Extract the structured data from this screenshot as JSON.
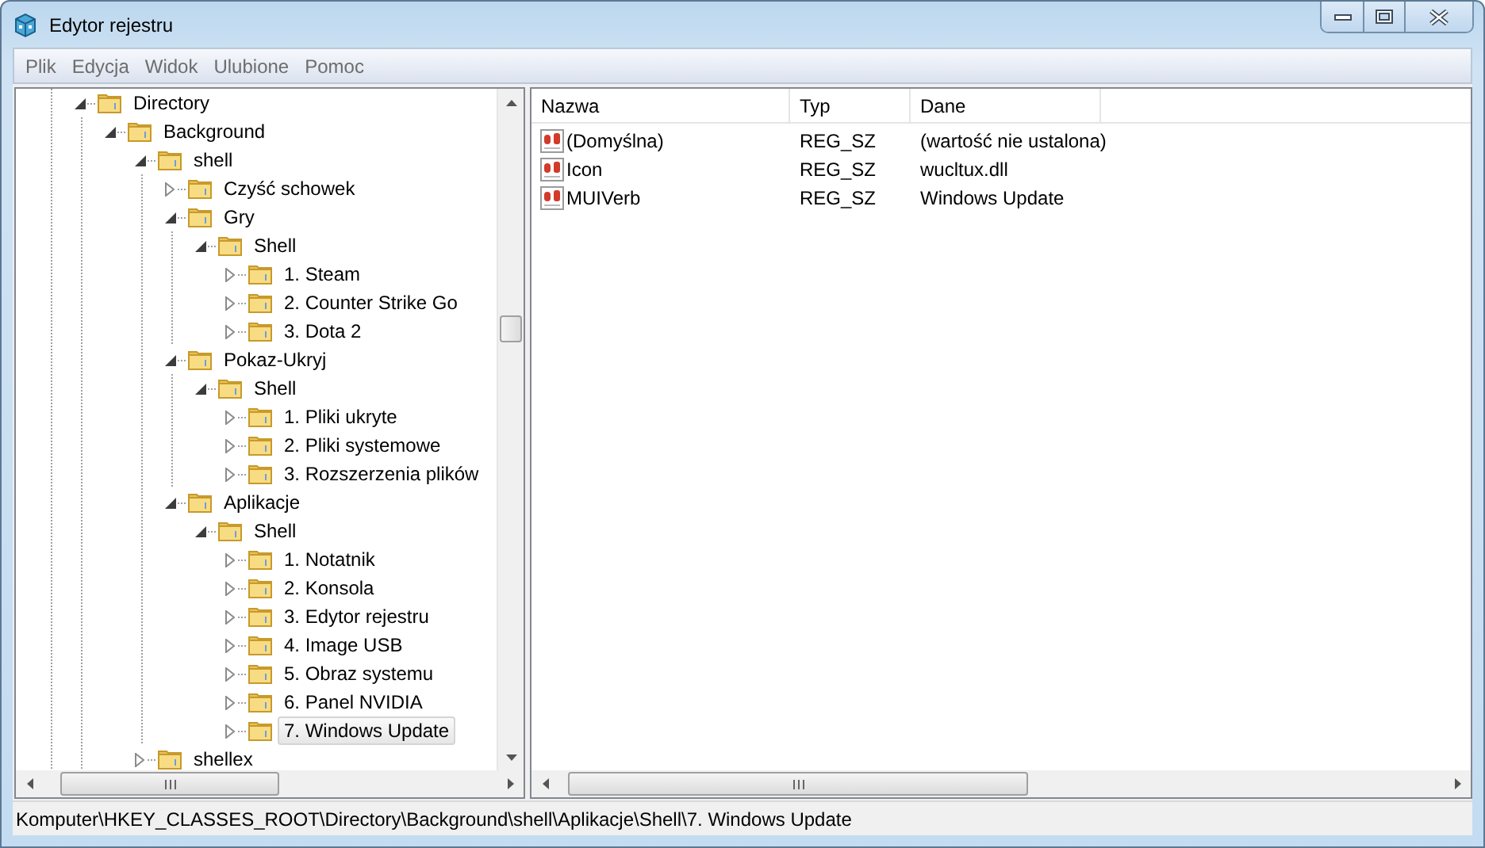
{
  "window": {
    "title": "Edytor rejestru"
  },
  "menu": [
    {
      "label": "Plik",
      "disabled": true
    },
    {
      "label": "Edycja",
      "disabled": true
    },
    {
      "label": "Widok",
      "disabled": true
    },
    {
      "label": "Ulubione",
      "disabled": true
    },
    {
      "label": "Pomoc",
      "disabled": true
    }
  ],
  "tree": [
    {
      "label": "Directory",
      "expanded": true,
      "selected": false,
      "children": [
        {
          "label": "Background",
          "expanded": true,
          "selected": false,
          "children": [
            {
              "label": "shell",
              "expanded": true,
              "selected": false,
              "children": [
                {
                  "label": "Czyść schowek",
                  "expanded": false,
                  "selected": false
                },
                {
                  "label": "Gry",
                  "expanded": true,
                  "selected": false,
                  "children": [
                    {
                      "label": "Shell",
                      "expanded": true,
                      "selected": false,
                      "children": [
                        {
                          "label": "1. Steam",
                          "expanded": false,
                          "selected": false
                        },
                        {
                          "label": "2. Counter Strike Go",
                          "expanded": false,
                          "selected": false
                        },
                        {
                          "label": "3. Dota 2",
                          "expanded": false,
                          "selected": false
                        }
                      ]
                    }
                  ]
                },
                {
                  "label": "Pokaz-Ukryj",
                  "expanded": true,
                  "selected": false,
                  "children": [
                    {
                      "label": "Shell",
                      "expanded": true,
                      "selected": false,
                      "children": [
                        {
                          "label": "1. Pliki ukryte",
                          "expanded": false,
                          "selected": false
                        },
                        {
                          "label": "2. Pliki systemowe",
                          "expanded": false,
                          "selected": false
                        },
                        {
                          "label": "3. Rozszerzenia plików",
                          "expanded": false,
                          "selected": false
                        }
                      ]
                    }
                  ]
                },
                {
                  "label": "Aplikacje",
                  "expanded": true,
                  "selected": false,
                  "children": [
                    {
                      "label": "Shell",
                      "expanded": true,
                      "selected": false,
                      "children": [
                        {
                          "label": "1. Notatnik",
                          "expanded": false,
                          "selected": false
                        },
                        {
                          "label": "2. Konsola",
                          "expanded": false,
                          "selected": false
                        },
                        {
                          "label": "3. Edytor rejestru",
                          "expanded": false,
                          "selected": false
                        },
                        {
                          "label": "4. Image USB",
                          "expanded": false,
                          "selected": false
                        },
                        {
                          "label": "5. Obraz systemu",
                          "expanded": false,
                          "selected": false
                        },
                        {
                          "label": "6. Panel NVIDIA",
                          "expanded": false,
                          "selected": false
                        },
                        {
                          "label": "7. Windows Update",
                          "expanded": false,
                          "selected": true
                        }
                      ]
                    }
                  ]
                }
              ]
            },
            {
              "label": "shellex",
              "expanded": false,
              "selected": false
            }
          ]
        }
      ]
    }
  ],
  "values": {
    "columns": [
      "Nazwa",
      "Typ",
      "Dane"
    ],
    "rows": [
      {
        "name": "(Domyślna)",
        "type": "REG_SZ",
        "data": "(wartość nie ustalona)"
      },
      {
        "name": "Icon",
        "type": "REG_SZ",
        "data": "wucltux.dll"
      },
      {
        "name": "MUIVerb",
        "type": "REG_SZ",
        "data": "Windows Update"
      }
    ]
  },
  "status_bar": "Komputer\\HKEY_CLASSES_ROOT\\Directory\\Background\\shell\\Aplikacje\\Shell\\7. Windows Update"
}
